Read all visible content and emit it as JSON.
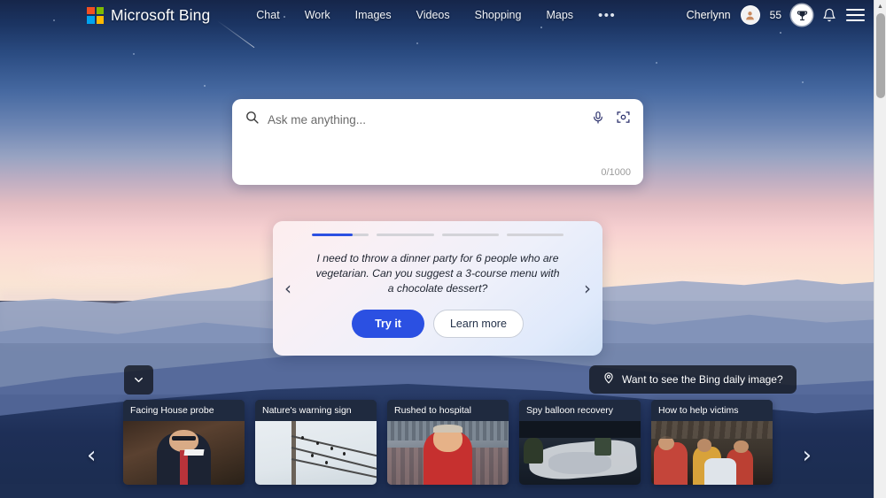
{
  "brand": {
    "name": "Microsoft Bing",
    "logo_icon": "microsoft-logo-icon",
    "logo_colors": [
      "#f25022",
      "#7fba00",
      "#00a4ef",
      "#ffb900"
    ]
  },
  "nav": {
    "links": [
      {
        "label": "Chat"
      },
      {
        "label": "Work"
      },
      {
        "label": "Images"
      },
      {
        "label": "Videos"
      },
      {
        "label": "Shopping"
      },
      {
        "label": "Maps"
      }
    ],
    "more_label": "•••",
    "more_icon": "more-horizontal-icon"
  },
  "account": {
    "username": "Cherlynn",
    "avatar_icon": "user-avatar-icon",
    "rewards_points": "55",
    "rewards_icon": "rewards-trophy-icon",
    "notifications_icon": "bell-icon",
    "menu_icon": "hamburger-menu-icon"
  },
  "scrollbar": {
    "up_arrow_icon": "scroll-up-arrow-icon",
    "thumb_icon": "scrollbar-thumb"
  },
  "search": {
    "placeholder": "Ask me anything...",
    "value": "",
    "counter": "0/1000",
    "search_icon": "search-icon",
    "mic_icon": "microphone-icon",
    "visual_search_icon": "visual-search-camera-icon"
  },
  "suggestion_card": {
    "segments": [
      {
        "filled_pct": 72,
        "active": true
      },
      {
        "filled_pct": 0,
        "active": false
      },
      {
        "filled_pct": 0,
        "active": false
      },
      {
        "filled_pct": 0,
        "active": false
      }
    ],
    "prompt": "I need to throw a dinner party for 6 people who are vegetarian. Can you suggest a 3-course menu with a chocolate dessert?",
    "try_label": "Try it",
    "learn_label": "Learn more",
    "prev_icon": "chevron-left-icon",
    "next_icon": "chevron-right-icon",
    "accent": "#2b50e2"
  },
  "daily_image_pill": {
    "label": "Want to see the Bing daily image?",
    "pin_icon": "location-pin-icon"
  },
  "collapse_toggle": {
    "icon": "chevron-down-icon"
  },
  "news": {
    "prev_icon": "carousel-prev-icon",
    "next_icon": "carousel-next-icon",
    "cards": [
      {
        "title": "Facing House probe",
        "image": "man-in-suit-at-hearing"
      },
      {
        "title": "Nature's warning sign",
        "image": "birds-on-power-lines"
      },
      {
        "title": "Rushed to hospital",
        "image": "man-in-red-shirt-at-stadium"
      },
      {
        "title": "Spy balloon recovery",
        "image": "navy-crew-recovering-debris"
      },
      {
        "title": "How to help victims",
        "image": "crowd-receiving-aid"
      }
    ]
  }
}
